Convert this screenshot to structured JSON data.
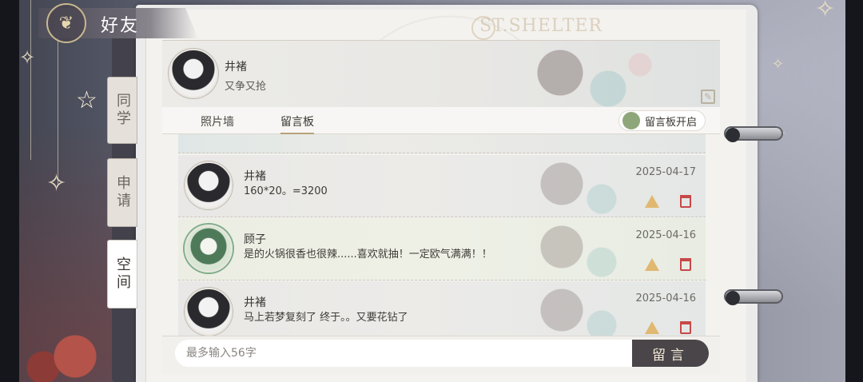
{
  "header": {
    "title": "好友",
    "logo_text": "ST.SHELTER"
  },
  "side_tabs": [
    {
      "label": "同学",
      "active": false
    },
    {
      "label": "申请",
      "active": false
    },
    {
      "label": "空间",
      "active": true
    }
  ],
  "profile": {
    "name": "井褚",
    "signature": "又争又抢"
  },
  "tabs": [
    {
      "label": "照片墙",
      "active": false
    },
    {
      "label": "留言板",
      "active": true
    }
  ],
  "toggle": {
    "label": "留言板开启",
    "color": "#8fa67a"
  },
  "messages": [
    {
      "name": "井褚",
      "text": "160*20。=3200",
      "date": "2025-04-17"
    },
    {
      "name": "顾子",
      "text": "是的火锅很香也很辣......喜欢就抽！一定欧气满满！！",
      "date": "2025-04-16"
    },
    {
      "name": "井褚",
      "text": "马上若梦复刻了 终于。。又要花钻了",
      "date": "2025-04-16"
    }
  ],
  "composer": {
    "placeholder": "最多输入56字",
    "send_label": "留言"
  },
  "colors": {
    "accent": "#b8a27a",
    "delete": "#c74848",
    "warning": "#e0b870",
    "send_button": "#4a4549"
  }
}
